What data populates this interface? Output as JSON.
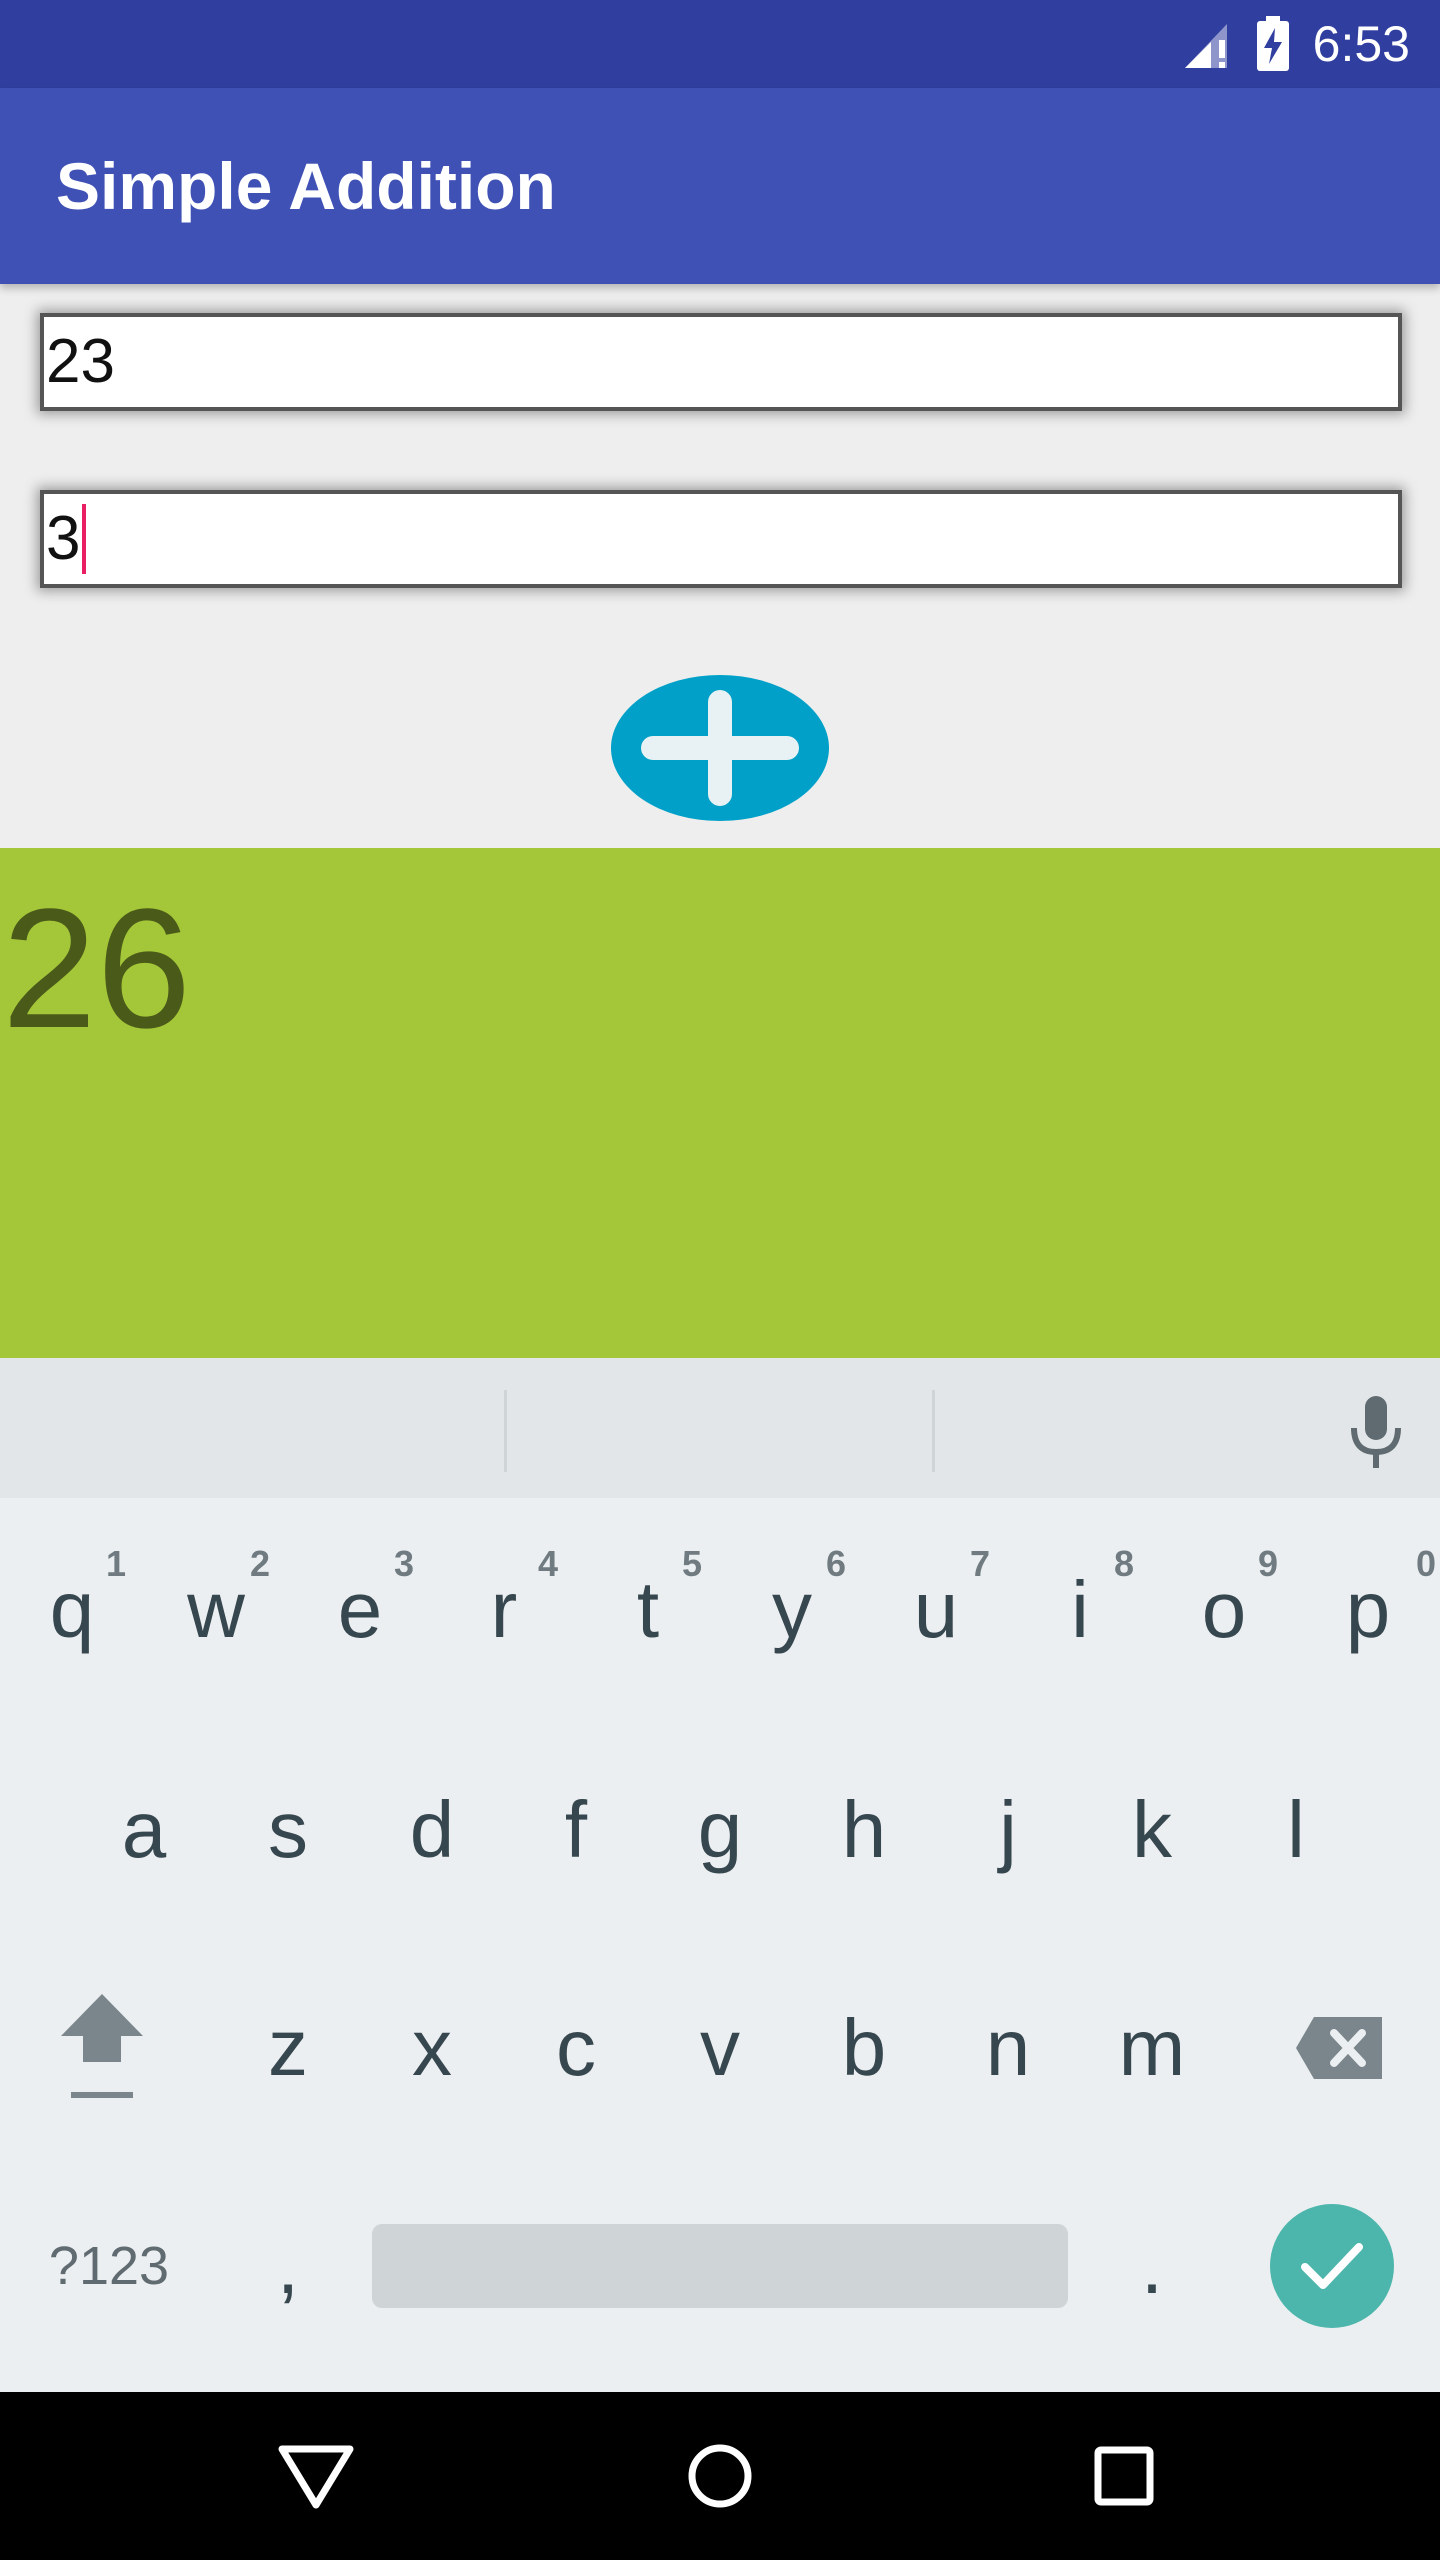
{
  "status_bar": {
    "time": "6:53",
    "icons": [
      "signal-icon",
      "battery-charging-icon"
    ]
  },
  "app_bar": {
    "title": "Simple Addition"
  },
  "form": {
    "first_number": "23",
    "second_number": "3",
    "add_button_icon": "plus-icon"
  },
  "result": {
    "value": "26"
  },
  "colors": {
    "status_bar": "#303f9f",
    "app_bar": "#3f51b5",
    "result_background": "#a4c639",
    "result_text": "#4a5a18",
    "add_button": "#00a0c8",
    "caret": "#e91e63",
    "done_key": "#4db6ac"
  },
  "keyboard": {
    "row1": [
      {
        "letter": "q",
        "hint": "1"
      },
      {
        "letter": "w",
        "hint": "2"
      },
      {
        "letter": "e",
        "hint": "3"
      },
      {
        "letter": "r",
        "hint": "4"
      },
      {
        "letter": "t",
        "hint": "5"
      },
      {
        "letter": "y",
        "hint": "6"
      },
      {
        "letter": "u",
        "hint": "7"
      },
      {
        "letter": "i",
        "hint": "8"
      },
      {
        "letter": "o",
        "hint": "9"
      },
      {
        "letter": "p",
        "hint": "0"
      }
    ],
    "row2": [
      "a",
      "s",
      "d",
      "f",
      "g",
      "h",
      "j",
      "k",
      "l"
    ],
    "row3": [
      "z",
      "x",
      "c",
      "v",
      "b",
      "n",
      "m"
    ],
    "symbols_label": "?123",
    "comma": ",",
    "period": ".",
    "shift_icon": "shift-icon",
    "backspace_icon": "backspace-icon",
    "mic_icon": "microphone-icon",
    "done_icon": "checkmark-icon"
  },
  "nav_bar": {
    "icons": [
      "back-icon",
      "home-icon",
      "recents-icon"
    ]
  }
}
